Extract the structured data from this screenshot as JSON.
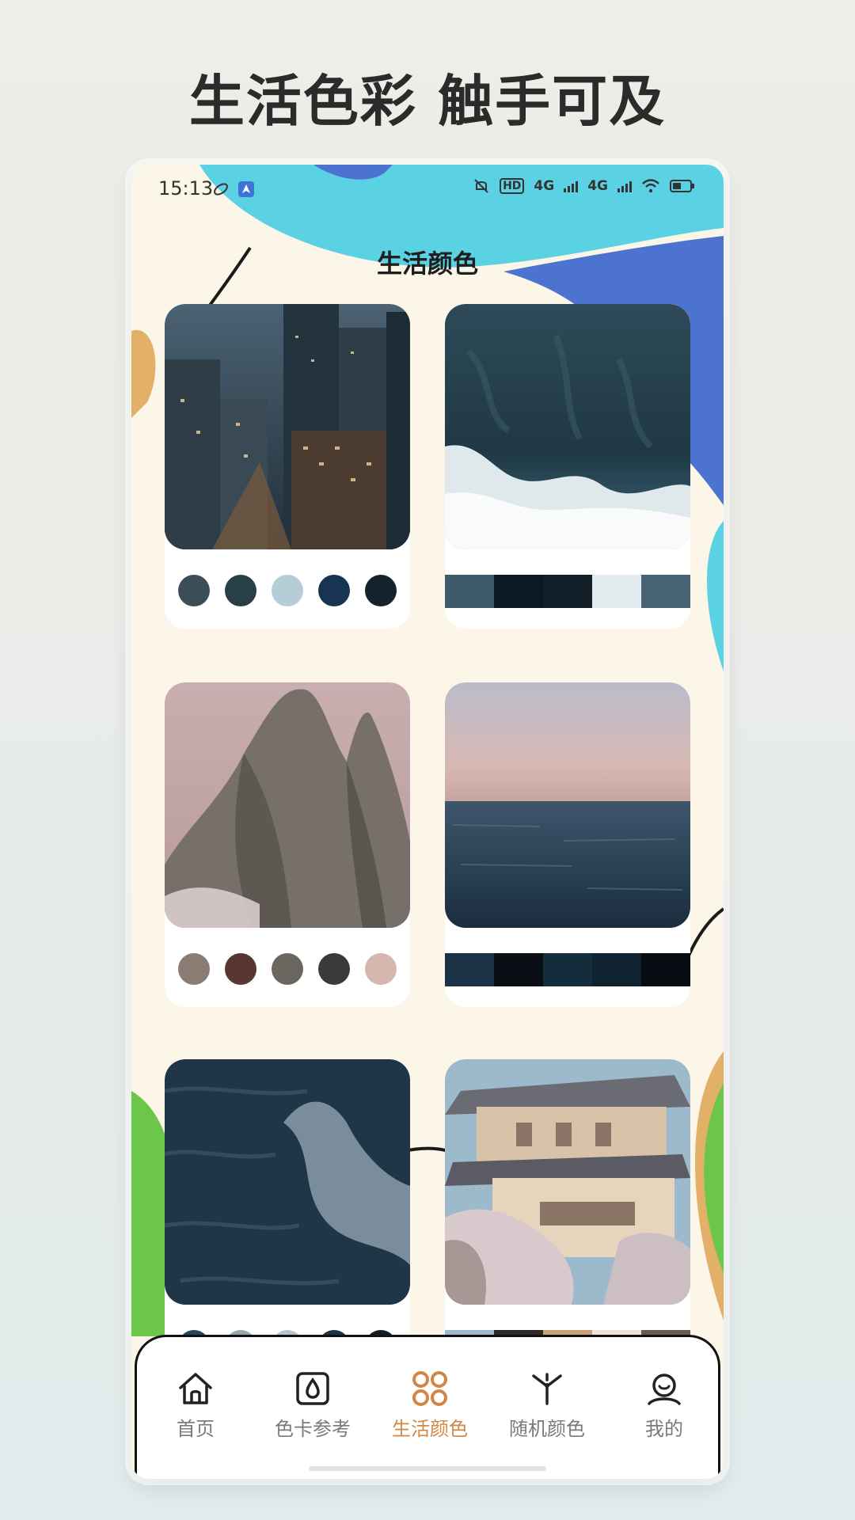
{
  "headline": "生活色彩 触手可及",
  "status_bar": {
    "time": "15:13",
    "network_1": "4G",
    "network_2": "4G",
    "hd_label": "HD"
  },
  "page_title": "生活颜色",
  "cards": [
    {
      "name": "city-night",
      "style": "dots",
      "colors": [
        "#3b4d57",
        "#283f47",
        "#b4cdd7",
        "#173552",
        "#14222b"
      ]
    },
    {
      "name": "ocean-waves-aerial",
      "style": "strip",
      "colors": [
        "#3f5b6a",
        "#0c1822",
        "#121e28",
        "#e2ebee",
        "#486474"
      ]
    },
    {
      "name": "rocky-peak",
      "style": "dots",
      "colors": [
        "#8a7c73",
        "#5a3633",
        "#6b6760",
        "#383b38",
        "#d6b7ae"
      ]
    },
    {
      "name": "sea-horizon",
      "style": "strip",
      "colors": [
        "#1b3146",
        "#0a0e15",
        "#142d3d",
        "#0f2230",
        "#080c12"
      ]
    },
    {
      "name": "deep-sea",
      "style": "dots",
      "colors": [
        "#2a4456",
        "#9aa7ae",
        "#b7c4cb",
        "#1c3344",
        "#101b24"
      ]
    },
    {
      "name": "japanese-castle",
      "style": "strip",
      "colors": [
        "#9db9cc",
        "#2d2a29",
        "#c9a17d",
        "#efe3d8",
        "#6a5a55"
      ]
    }
  ],
  "tabs": [
    {
      "label": "首页",
      "icon": "home-icon",
      "active": false
    },
    {
      "label": "色卡参考",
      "icon": "color-card-icon",
      "active": false
    },
    {
      "label": "生活颜色",
      "icon": "life-colors-icon",
      "active": true
    },
    {
      "label": "随机颜色",
      "icon": "random-color-icon",
      "active": false
    },
    {
      "label": "我的",
      "icon": "profile-icon",
      "active": false
    }
  ],
  "colors": {
    "accent": "#d28646",
    "phone_bg": "#fbf6e7",
    "deco_cyan": "#5ad2e3",
    "deco_blue": "#4b73cf",
    "deco_green": "#6cc64a",
    "deco_orange": "#e3b06a"
  }
}
